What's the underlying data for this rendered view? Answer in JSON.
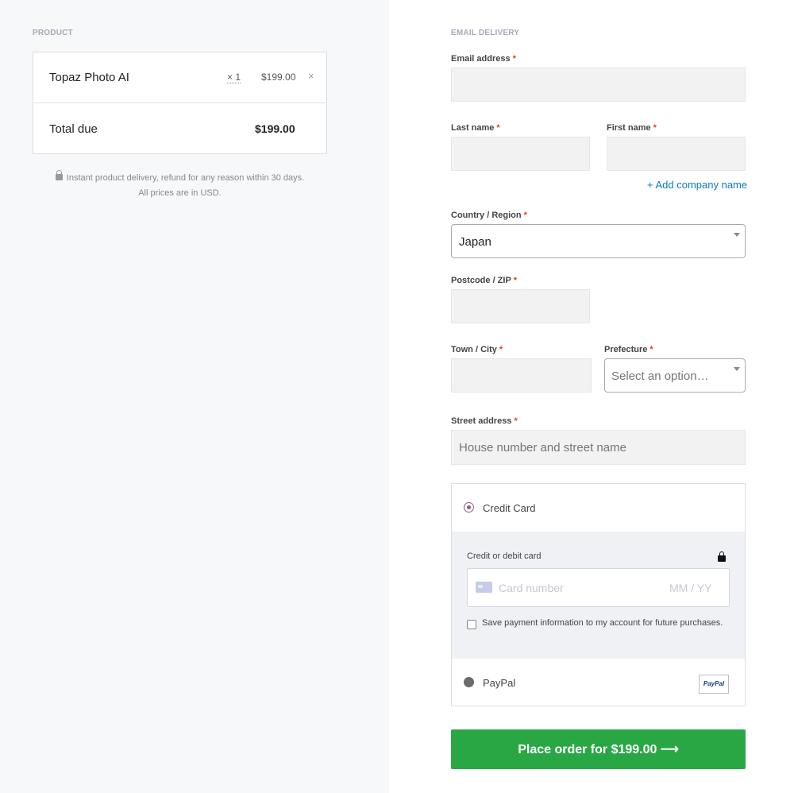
{
  "product_section": {
    "heading": "PRODUCT",
    "item": {
      "name": "Topaz Photo AI",
      "qty": "× 1",
      "price": "$199.00",
      "remove": "×"
    },
    "total": {
      "label": "Total due",
      "value": "$199.00"
    },
    "note_line1": "Instant product delivery, refund for any reason within 30 days.",
    "note_line2": "All prices are in USD."
  },
  "delivery": {
    "heading": "EMAIL DELIVERY",
    "required_marker": "*",
    "email_label": "Email address",
    "last_name_label": "Last name",
    "first_name_label": "First name",
    "add_company": "+ Add company name",
    "country_label": "Country / Region",
    "country_value": "Japan",
    "postcode_label": "Postcode / ZIP",
    "town_label": "Town / City",
    "prefecture_label": "Prefecture",
    "prefecture_placeholder": "Select an option…",
    "street_label": "Street address",
    "street_placeholder": "House number and street name"
  },
  "payment": {
    "credit_card_label": "Credit Card",
    "card_panel_label": "Credit or debit card",
    "card_number_placeholder": "Card number",
    "card_expiry_placeholder": "MM / YY",
    "save_label": "Save payment information to my account for future purchases.",
    "paypal_label": "PayPal",
    "paypal_logo_text": "PayPal",
    "selected_method": "Credit Card"
  },
  "place_order_label": "Place order for $199.00 ⟶",
  "colors": {
    "accent_green": "#29a745",
    "radio_purple": "#96588a",
    "link_blue": "#0a7ac4",
    "required_red": "#e2401c"
  },
  "icons": [
    "lock-icon",
    "close-icon",
    "chevron-down-icon",
    "credit-card-icon",
    "paypal-logo",
    "arrow-right-icon"
  ]
}
